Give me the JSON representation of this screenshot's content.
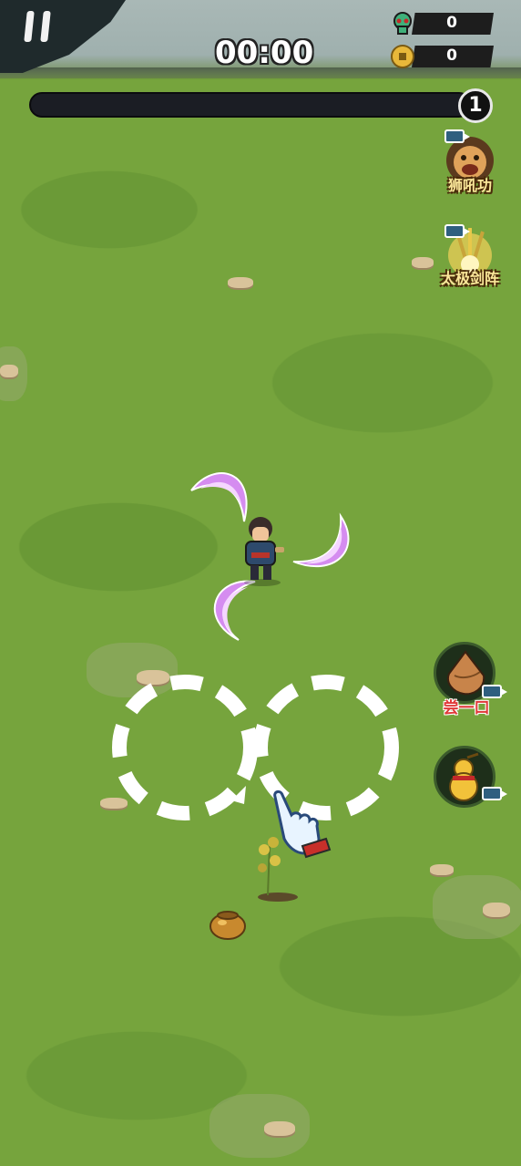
{
  "hud": {
    "timer": "00:00",
    "kills": "0",
    "coins": "0",
    "level": "1",
    "xp_fraction": 0.0
  },
  "skills": [
    {
      "label": "狮吼功",
      "icon": "roaring-lion-icon"
    },
    {
      "label": "太极剑阵",
      "icon": "taiji-sword-array-icon"
    }
  ],
  "items": [
    {
      "label": "尝一口",
      "icon": "meat-dumpling-icon"
    },
    {
      "label": "",
      "icon": "gourd-icon"
    }
  ],
  "colors": {
    "grass": "#76a43d",
    "xp_bar": "#1b1d24",
    "blade": "#d58cf0",
    "tutorial_ring": "#ffffff"
  }
}
